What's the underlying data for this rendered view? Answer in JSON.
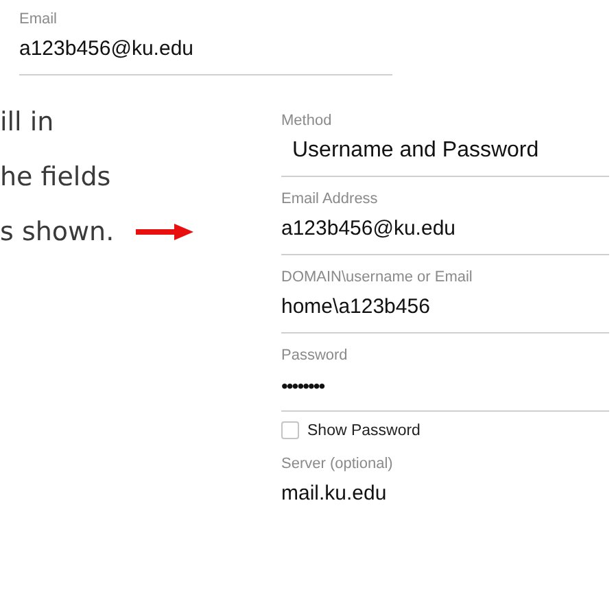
{
  "account_field": {
    "label": "Email",
    "value": "a123b456@ku.edu"
  },
  "instruction": {
    "lines": [
      "ill in",
      "he fields",
      "s shown."
    ]
  },
  "form": {
    "fields": [
      {
        "kind": "select",
        "label": "Method",
        "value": "Username and Password"
      },
      {
        "kind": "text",
        "label": "Email Address",
        "value": "a123b456@ku.edu"
      },
      {
        "kind": "text",
        "label": "DOMAIN\\username or Email",
        "value": "home\\a123b456"
      },
      {
        "kind": "password",
        "label": "Password",
        "value": "••••••••"
      },
      {
        "kind": "checkbox",
        "label": "Show Password",
        "checked": false
      },
      {
        "kind": "text",
        "label": "Server (optional)",
        "value": "mail.ku.edu"
      }
    ]
  }
}
